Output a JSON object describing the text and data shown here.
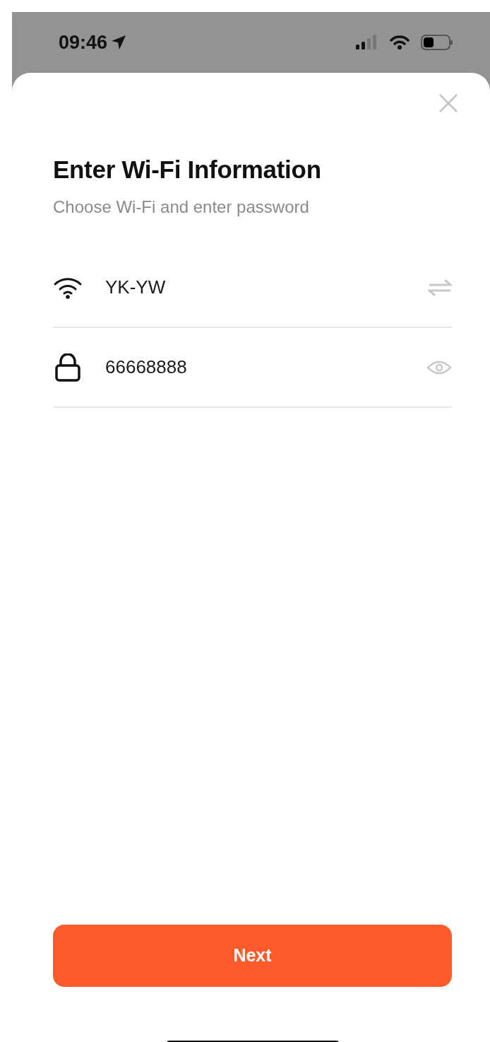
{
  "status_bar": {
    "time": "09:46"
  },
  "sheet": {
    "title": "Enter Wi-Fi Information",
    "subtitle": "Choose Wi-Fi and enter password"
  },
  "fields": [
    {
      "kind": "wifi",
      "value": "YK-YW"
    },
    {
      "kind": "password",
      "value": "66668888"
    }
  ],
  "buttons": [
    "Next"
  ]
}
